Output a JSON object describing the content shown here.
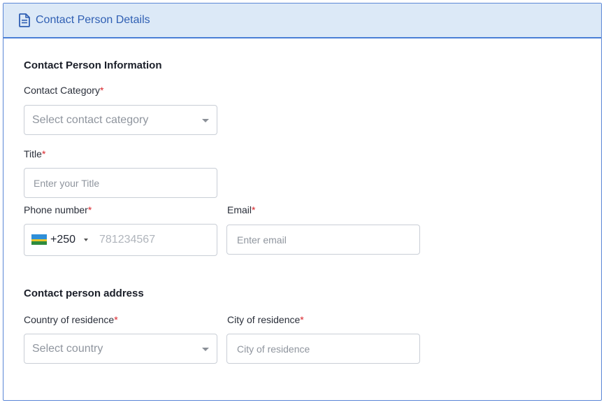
{
  "header": {
    "title": "Contact Person Details",
    "icon": "document-icon"
  },
  "contact_info": {
    "section_title": "Contact Person Information",
    "category": {
      "label": "Contact Category",
      "required_mark": "*",
      "placeholder": "Select contact category"
    },
    "title": {
      "label": "Title",
      "required_mark": "*",
      "placeholder": "Enter your Title"
    },
    "phone": {
      "label": "Phone number",
      "required_mark": "*",
      "country_code": "+250",
      "placeholder": "781234567",
      "flag": "rwanda-flag"
    },
    "email": {
      "label": "Email",
      "required_mark": "*",
      "placeholder": "Enter email"
    }
  },
  "address": {
    "section_title": "Contact person address",
    "country": {
      "label": "Country of residence",
      "required_mark": "*",
      "placeholder": "Select country"
    },
    "city": {
      "label": "City of residence",
      "required_mark": "*",
      "placeholder": "City of residence"
    }
  },
  "colors": {
    "header_bg": "#dce9f7",
    "accent": "#2f5fb3",
    "required": "#d9252b"
  }
}
